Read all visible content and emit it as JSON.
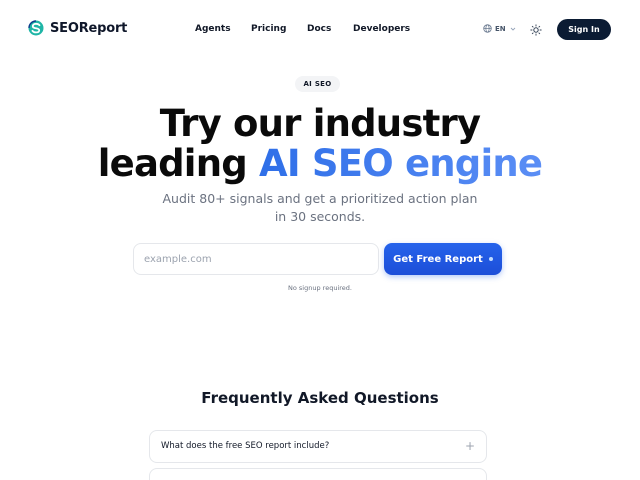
{
  "brand": {
    "name": "SEOReport"
  },
  "nav": {
    "items": [
      {
        "label": "Agents"
      },
      {
        "label": "Pricing"
      },
      {
        "label": "Docs"
      },
      {
        "label": "Developers"
      }
    ]
  },
  "header": {
    "language": "EN",
    "signin_label": "Sign In",
    "icons": {
      "language": "globe-icon",
      "language_menu": "chevron-down-icon",
      "theme": "sun-icon"
    }
  },
  "hero": {
    "badge": "AI SEO",
    "title_line1": "Try our industry",
    "title_line2_plain": "leading",
    "title_line2_accent": "AI SEO engine",
    "subtitle": "Audit 80+ signals and get a prioritized action plan in 30 seconds.",
    "input_placeholder": "example.com",
    "input_value": "",
    "cta_label": "Get Free Report",
    "note": "No signup required."
  },
  "faq": {
    "title": "Frequently Asked Questions",
    "items": [
      {
        "question": "What does the free SEO report include?"
      },
      {
        "question": ""
      }
    ]
  },
  "colors": {
    "accent": "#3b7bf0",
    "cta": "#2563eb",
    "signin_bg": "#0b1b33"
  }
}
